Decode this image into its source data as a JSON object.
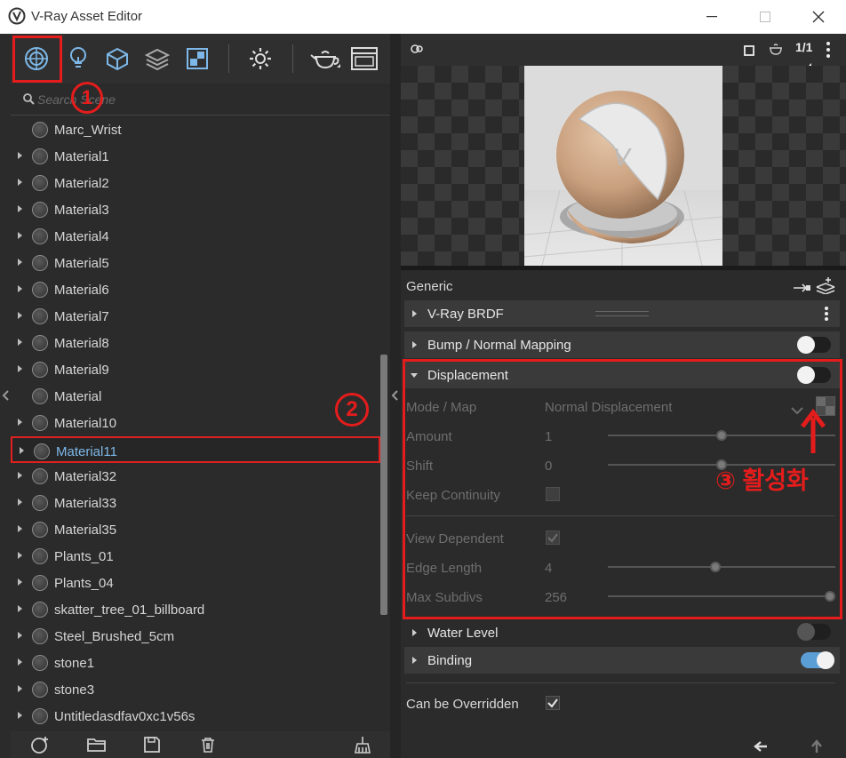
{
  "window": {
    "title": "V-Ray Asset Editor"
  },
  "left_toolbar": {
    "icons": [
      "materials-icon",
      "lights-icon",
      "geometry-icon",
      "layers-icon",
      "render-elements-icon",
      "settings-icon",
      "render-teapot-icon",
      "frame-buffer-icon"
    ]
  },
  "search": {
    "placeholder": "Search Scene"
  },
  "materials": {
    "items": [
      {
        "label": "Marc_Wrist",
        "expandable": false
      },
      {
        "label": "Material1",
        "expandable": true
      },
      {
        "label": "Material2",
        "expandable": true
      },
      {
        "label": "Material3",
        "expandable": true
      },
      {
        "label": "Material4",
        "expandable": true
      },
      {
        "label": "Material5",
        "expandable": true
      },
      {
        "label": "Material6",
        "expandable": true
      },
      {
        "label": "Material7",
        "expandable": true
      },
      {
        "label": "Material8",
        "expandable": true
      },
      {
        "label": "Material9",
        "expandable": true
      },
      {
        "label": "Material",
        "expandable": false
      },
      {
        "label": "Material10",
        "expandable": true
      },
      {
        "label": "Material11",
        "expandable": true,
        "selected": true
      },
      {
        "label": "Material32",
        "expandable": true
      },
      {
        "label": "Material33",
        "expandable": true
      },
      {
        "label": "Material35",
        "expandable": true
      },
      {
        "label": "Plants_01",
        "expandable": true
      },
      {
        "label": "Plants_04",
        "expandable": true
      },
      {
        "label": "skatter_tree_01_billboard",
        "expandable": true
      },
      {
        "label": "Steel_Brushed_5cm",
        "expandable": true
      },
      {
        "label": "stone1",
        "expandable": true
      },
      {
        "label": "stone3",
        "expandable": true
      },
      {
        "label": "Untitledasdfav0xc1v56s",
        "expandable": true
      }
    ]
  },
  "right_toolbar": {
    "ratio": "1/1"
  },
  "generic": {
    "label": "Generic"
  },
  "sections": {
    "vray_brdf": "V-Ray BRDF",
    "bump": "Bump / Normal Mapping",
    "displacement": "Displacement",
    "water_level": "Water Level",
    "binding": "Binding"
  },
  "displacement": {
    "mode_label": "Mode / Map",
    "mode_value": "Normal Displacement",
    "amount_label": "Amount",
    "amount_value": "1",
    "shift_label": "Shift",
    "shift_value": "0",
    "keep_continuity_label": "Keep Continuity",
    "view_dependent_label": "View Dependent",
    "edge_length_label": "Edge Length",
    "edge_length_value": "4",
    "max_subdivs_label": "Max Subdivs",
    "max_subdivs_value": "256"
  },
  "toggles": {
    "bump": false,
    "displacement": false,
    "water_level": false,
    "binding": true
  },
  "can_be_overridden": {
    "label": "Can be Overridden",
    "checked": true
  },
  "annotations": {
    "step1": "1",
    "step2": "2",
    "step3": "③ 활성화"
  },
  "colors": {
    "accent_blue": "#5b9ed6",
    "annotation_red": "#e51c1c",
    "selected_text": "#7db8e8"
  }
}
